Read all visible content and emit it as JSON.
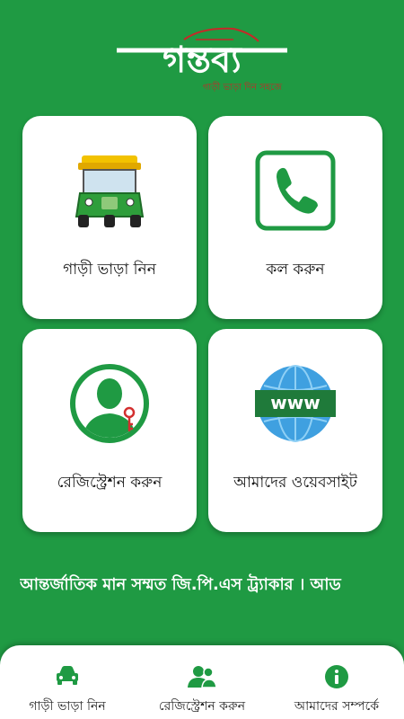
{
  "app": {
    "logo_text": "গন্তব্য",
    "logo_tagline": "গাড়ী ভাড়া দিন সহজে"
  },
  "cards": {
    "rent": {
      "label": "গাড়ী ভাড়া নিন",
      "icon": "auto-rickshaw-icon"
    },
    "call": {
      "label": "কল করুন",
      "icon": "phone-icon"
    },
    "register": {
      "label": "রেজিস্ট্রেশন করুন",
      "icon": "user-key-icon"
    },
    "website": {
      "label": "আমাদের ওয়েবসাইট",
      "icon": "www-globe-icon"
    }
  },
  "ticker": {
    "text": "আন্তর্জাতিক মান সম্মত জি.পি.এস ট্র্যাকার । আড"
  },
  "bottom_nav": {
    "items": [
      {
        "label": "গাড়ী ভাড়া নিন",
        "icon": "car-icon"
      },
      {
        "label": "রেজিস্ট্রেশন করুন",
        "icon": "users-icon"
      },
      {
        "label": "আমাদের সম্পর্কে",
        "icon": "info-icon"
      }
    ]
  },
  "colors": {
    "brand_green": "#1f9a43",
    "white": "#ffffff"
  }
}
